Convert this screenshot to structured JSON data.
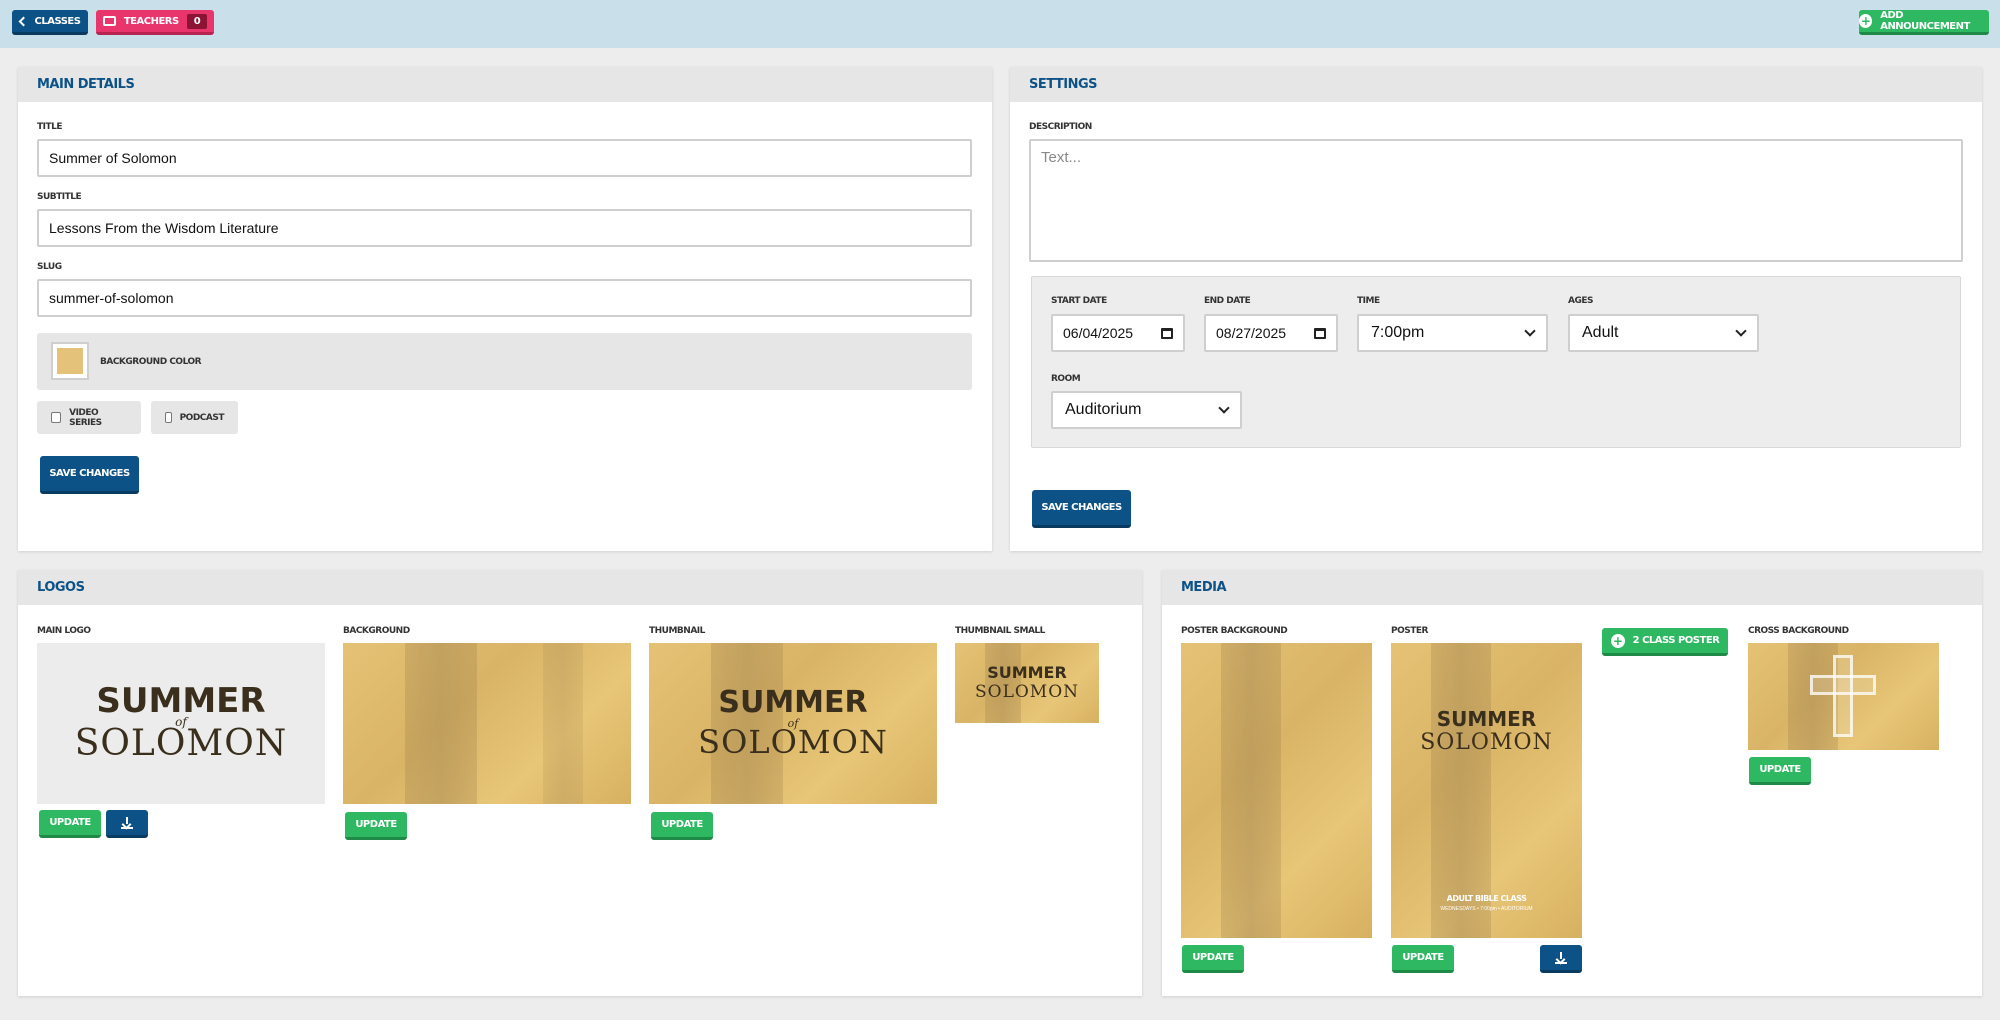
{
  "topbar": {
    "classes_label": "CLASSES",
    "teachers_label": "TEACHERS",
    "teachers_count": "0",
    "add_announcement_label": "ADD ANNOUNCEMENT"
  },
  "main_details": {
    "heading": "MAIN DETAILS",
    "title_label": "TITLE",
    "title_value": "Summer of Solomon",
    "subtitle_label": "SUBTITLE",
    "subtitle_value": "Lessons From the Wisdom Literature",
    "slug_label": "SLUG",
    "slug_value": "summer-of-solomon",
    "background_color_label": "BACKGROUND COLOR",
    "background_color": "#e4c27a",
    "video_series_label": "VIDEO SERIES",
    "podcast_label": "PODCAST",
    "save_label": "SAVE CHANGES"
  },
  "settings": {
    "heading": "SETTINGS",
    "description_label": "DESCRIPTION",
    "description_placeholder": "Text...",
    "start_date_label": "START DATE",
    "start_date_value": "06/04/2025",
    "end_date_label": "END DATE",
    "end_date_value": "08/27/2025",
    "time_label": "TIME",
    "time_value": "7:00pm",
    "ages_label": "AGES",
    "ages_value": "Adult",
    "room_label": "ROOM",
    "room_value": "Auditorium",
    "save_label": "SAVE CHANGES"
  },
  "logos": {
    "heading": "LOGOS",
    "main_logo_label": "MAIN LOGO",
    "background_label": "BACKGROUND",
    "thumbnail_label": "THUMBNAIL",
    "thumbnail_small_label": "THUMBNAIL SMALL",
    "update_label": "UPDATE",
    "logo_line1": "SUMMER",
    "logo_of": "of",
    "logo_line2": "SOLOMON"
  },
  "media": {
    "heading": "MEDIA",
    "poster_background_label": "POSTER BACKGROUND",
    "poster_label": "POSTER",
    "class_poster_label": "2 CLASS POSTER",
    "cross_background_label": "CROSS BACKGROUND",
    "update_label": "UPDATE",
    "poster_caption": "ADULT BIBLE CLASS",
    "poster_subcaption": "WEDNESDAYS • 7:00pm • AUDITORIUM"
  },
  "colors": {
    "navy": "#0d5286",
    "pink": "#e8356b",
    "green": "#2fb862",
    "topbar": "#c9dfea"
  }
}
